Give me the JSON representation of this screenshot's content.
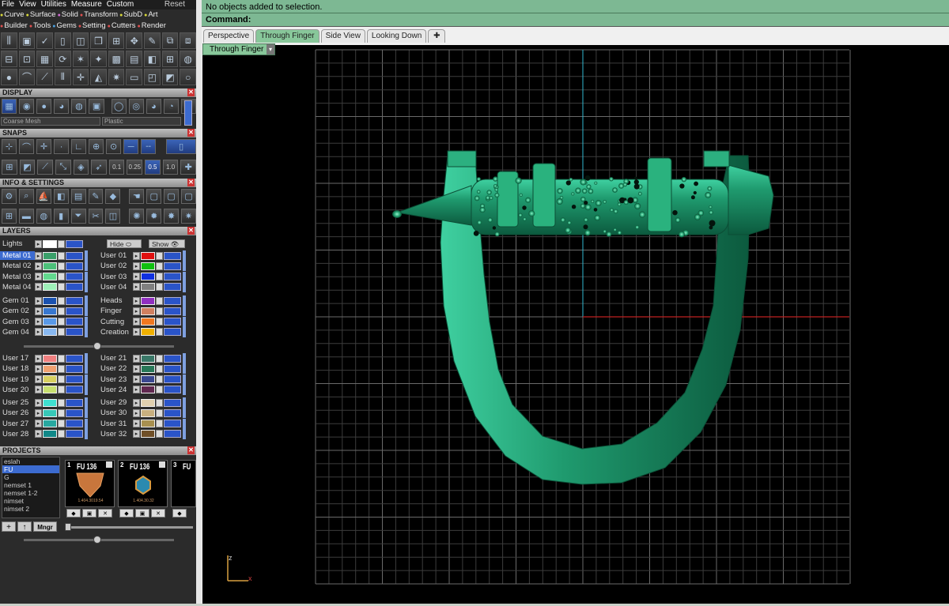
{
  "menu": {
    "items": [
      "File",
      "View",
      "Utilities",
      "Measure",
      "Custom"
    ],
    "reset": "Reset"
  },
  "plugins": {
    "row1": [
      {
        "label": "Curve",
        "color": "#d9d93a"
      },
      {
        "label": "Surface",
        "color": "#d9d93a"
      },
      {
        "label": "Solid",
        "color": "#d36bd3"
      },
      {
        "label": "Transform",
        "color": "#e05050"
      },
      {
        "label": "SubD",
        "color": "#d9d93a"
      },
      {
        "label": "Art",
        "color": "#d9d93a"
      }
    ],
    "row2": [
      {
        "label": "Builder",
        "color": "#e05050"
      },
      {
        "label": "Tools",
        "color": "#e05050"
      },
      {
        "label": "Gems",
        "color": "#4aa0e0"
      },
      {
        "label": "Setting",
        "color": "#e05050"
      },
      {
        "label": "Cutters",
        "color": "#e05050"
      },
      {
        "label": "Render",
        "color": "#e05050"
      }
    ]
  },
  "sections": {
    "display": "DISPLAY",
    "snaps": "SNAPS",
    "info": "INFO & SETTINGS",
    "layers": "LAYERS",
    "projects": "PROJECTS"
  },
  "display": {
    "mesh": "Coarse Mesh",
    "material": "Plastic"
  },
  "snaps": {
    "values": [
      "0.1",
      "0.25",
      "0.5",
      "1.0"
    ]
  },
  "layers": {
    "lights": "Lights",
    "hide": "Hide",
    "show": "Show",
    "left": [
      [
        "Metal 01",
        "Metal 02",
        "Metal 03",
        "Metal 04"
      ],
      [
        "Gem 01",
        "Gem 02",
        "Gem 03",
        "Gem 04"
      ],
      [
        "User 17",
        "User 18",
        "User 19",
        "User 20"
      ],
      [
        "User 25",
        "User 26",
        "User 27",
        "User 28"
      ]
    ],
    "right": [
      [
        "User 01",
        "User 02",
        "User 03",
        "User 04"
      ],
      [
        "Heads",
        "Finger",
        "Cutting",
        "Creation"
      ],
      [
        "User 21",
        "User 22",
        "User 23",
        "User 24"
      ],
      [
        "User 29",
        "User 30",
        "User 31",
        "User 32"
      ]
    ],
    "left_colors": [
      [
        "#3aa06a",
        "#4cc07a",
        "#62d88e",
        "#9ef0b8"
      ],
      [
        "#1a52b0",
        "#3878d0",
        "#5a9ae8",
        "#88b8f0"
      ],
      [
        "#f08080",
        "#f0a070",
        "#d8d060",
        "#c8e070"
      ],
      [
        "#40e0d0",
        "#38c8b8",
        "#28a8a0",
        "#108888"
      ]
    ],
    "right_colors": [
      [
        "#e01010",
        "#10c010",
        "#1030e0",
        "#808080"
      ],
      [
        "#9030c0",
        "#d08060",
        "#f07820",
        "#f0b000"
      ],
      [
        "#3a7868",
        "#287858",
        "#3a4890",
        "#602850"
      ],
      [
        "#e0d0b0",
        "#c8b080",
        "#a89050",
        "#705028"
      ]
    ]
  },
  "projects": {
    "items": [
      "eslah",
      "FU",
      "G",
      "nemset 1",
      "nemset 1-2",
      "nimset",
      "nimset 2"
    ],
    "selected": "FU",
    "thumbs": [
      {
        "n": "1",
        "t": "FU 136",
        "s": "1.404.3019.54"
      },
      {
        "n": "2",
        "t": "FU 136",
        "s": "1.404.30.32"
      },
      {
        "n": "3",
        "t": "FU",
        "s": ""
      }
    ],
    "mngr": "Mngr"
  },
  "status": {
    "message": "No objects added to selection.",
    "command": "Command:"
  },
  "tabs": [
    "Perspective",
    "Through Finger",
    "Side View",
    "Looking Down"
  ],
  "active_tab": "Through Finger",
  "viewport_title": "Through Finger",
  "axis_labels": {
    "z": "z",
    "x": "x"
  },
  "colors": {
    "ring": "#1f9a6e",
    "ring_light": "#3fd0a0",
    "ring_dark": "#0c5a3e",
    "grid": "#555555",
    "axis_y": "#2fb8d0",
    "axis_x": "#c02020"
  }
}
